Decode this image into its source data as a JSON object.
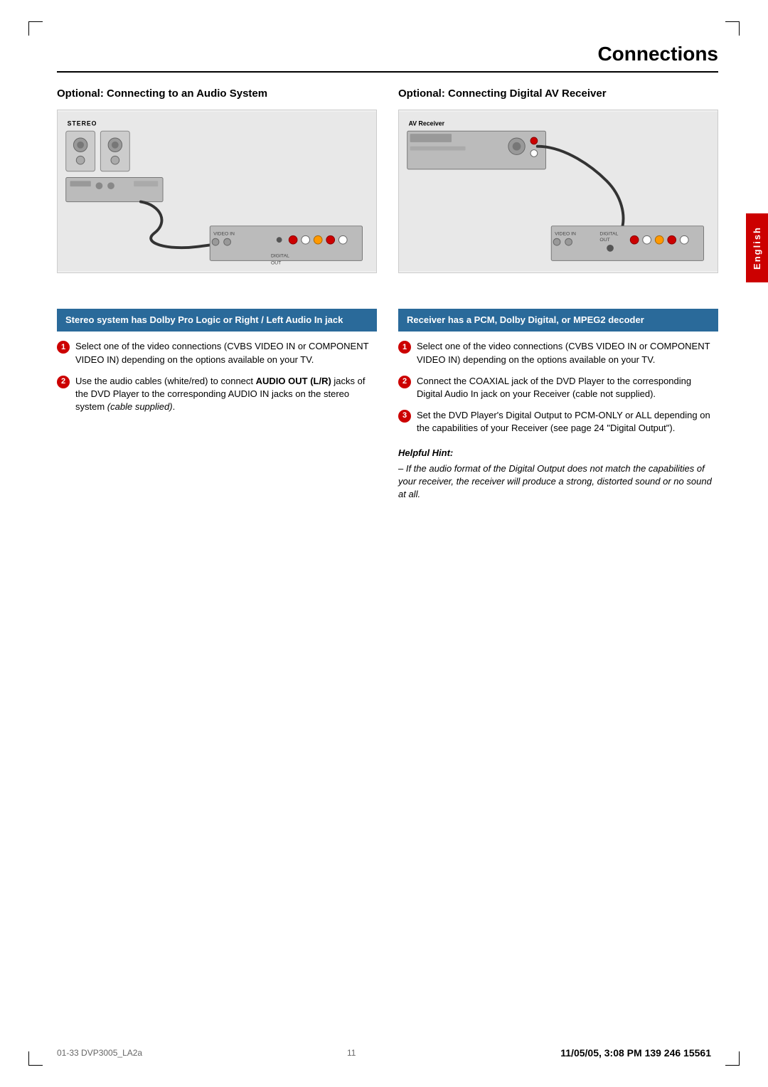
{
  "page": {
    "title": "Connections",
    "page_number": "11",
    "footer_left": "01-33 DVP3005_LA2a",
    "footer_center": "11",
    "footer_right": "139 246 15561",
    "footer_date": "11/05/05, 3:08 PM"
  },
  "side_tab": "English",
  "left_section": {
    "title": "Optional: Connecting to an Audio System",
    "info_box": "Stereo system has Dolby Pro Logic or Right / Left Audio In jack",
    "steps": [
      {
        "num": "1",
        "text": "Select one of the video connections (CVBS VIDEO IN or COMPONENT VIDEO IN) depending on the options available on your TV."
      },
      {
        "num": "2",
        "text": "Use the audio cables (white/red) to connect AUDIO OUT (L/R) jacks of the DVD Player to the corresponding AUDIO IN jacks on the stereo system (cable supplied).",
        "bold_part": "AUDIO OUT (L/R)"
      }
    ]
  },
  "right_section": {
    "title": "Optional: Connecting Digital AV Receiver",
    "info_box": "Receiver has a PCM, Dolby Digital, or MPEG2 decoder",
    "steps": [
      {
        "num": "1",
        "text": "Select one of the video connections (CVBS VIDEO IN or COMPONENT VIDEO IN) depending on the options available on your TV."
      },
      {
        "num": "2",
        "text": "Connect the COAXIAL jack of the DVD Player to the corresponding Digital Audio In jack on your Receiver (cable not supplied)."
      },
      {
        "num": "3",
        "text": "Set the DVD Player's Digital Output to PCM-ONLY or ALL depending on the capabilities of your Receiver (see page 24 \"Digital Output\")."
      }
    ],
    "helpful_hint": {
      "title": "Helpful Hint:",
      "body": "– If the audio format of the Digital Output does not match the capabilities of your receiver, the receiver will produce a strong, distorted sound or no sound at all."
    }
  },
  "diagrams": {
    "left_label": "STEREO",
    "right_label": "AV Receiver"
  }
}
